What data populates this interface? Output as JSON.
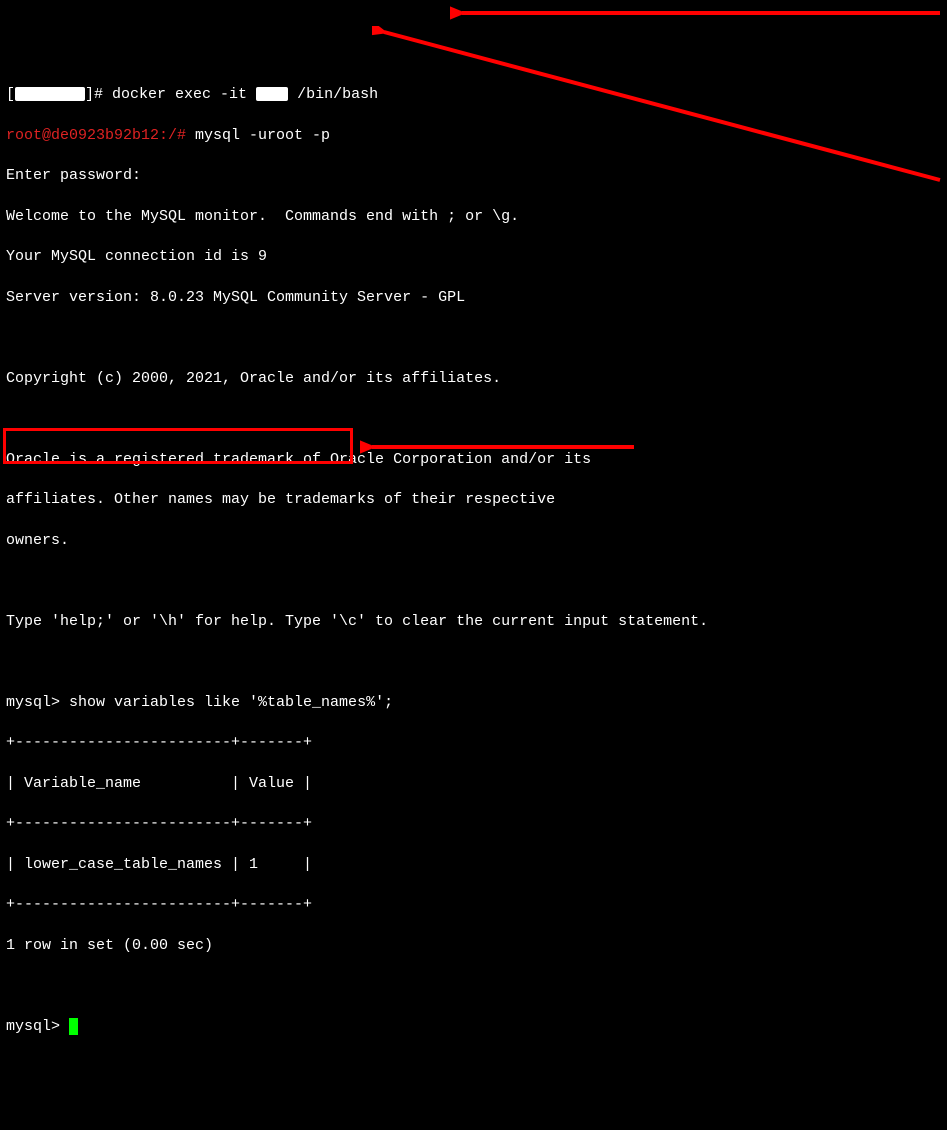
{
  "prompt1_open": "[",
  "prompt1_close": "]# ",
  "cmd1": "docker exec -it ",
  "cmd1_end": " /bin/bash",
  "prompt2": "root@de0923b92b12:/# ",
  "cmd2": "mysql -uroot -p",
  "enter_pw": "Enter password:",
  "welcome": "Welcome to the MySQL monitor.  Commands end with ; or \\g.",
  "conn_id": "Your MySQL connection id is 9",
  "server_ver": "Server version: 8.0.23 MySQL Community Server - GPL",
  "copyright": "Copyright (c) 2000, 2021, Oracle and/or its affiliates.",
  "oracle1": "Oracle is a registered trademark of Oracle Corporation and/or its",
  "oracle2": "affiliates. Other names may be trademarks of their respective",
  "oracle3": "owners.",
  "help_line": "Type 'help;' or '\\h' for help. Type '\\c' to clear the current input statement.",
  "mysql_prompt": "mysql> ",
  "query": "show variables like '%table_names%';",
  "tbl_border": "+------------------------+-------+",
  "tbl_header": "| Variable_name          | Value |",
  "tbl_row": "| lower_case_table_names | 1     |",
  "result_info": "1 row in set (0.00 sec)",
  "chart_data": {
    "type": "table",
    "columns": [
      "Variable_name",
      "Value"
    ],
    "rows": [
      [
        "lower_case_table_names",
        "1"
      ]
    ]
  }
}
